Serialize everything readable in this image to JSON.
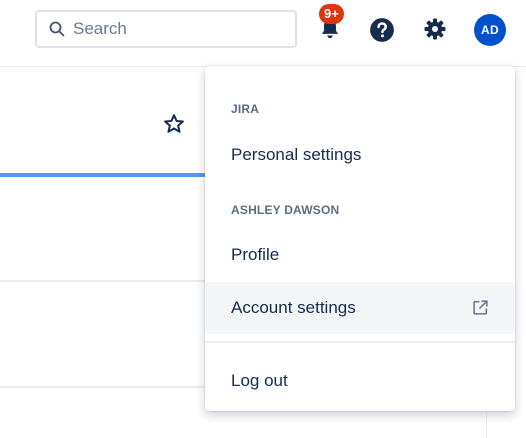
{
  "search": {
    "placeholder": "Search",
    "icon": "search-icon"
  },
  "notifications": {
    "icon": "notification-icon",
    "badge": "9+",
    "badge_color": "#de350b"
  },
  "help": {
    "icon": "help-icon"
  },
  "settings": {
    "icon": "gear-icon"
  },
  "user": {
    "initials": "AD",
    "avatar_color": "#0052cc"
  },
  "page": {
    "star_icon": "star-icon",
    "active_tab_color": "#4c9aff"
  },
  "menu": {
    "groups": [
      {
        "heading": "JIRA",
        "items": [
          {
            "label": "Personal settings"
          }
        ]
      },
      {
        "heading": "ASHLEY DAWSON",
        "items": [
          {
            "label": "Profile"
          },
          {
            "label": "Account settings",
            "icon": "external-link-icon"
          }
        ]
      }
    ],
    "logout_label": "Log out"
  }
}
